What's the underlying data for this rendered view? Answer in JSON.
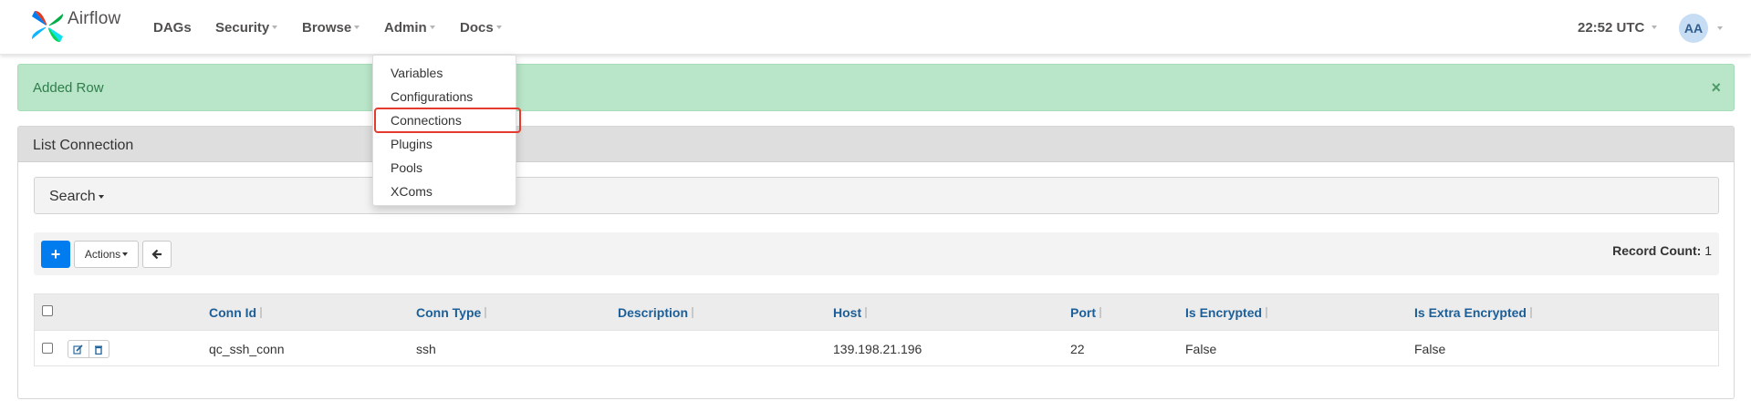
{
  "navbar": {
    "logo_text": "Airflow",
    "items": [
      {
        "label": "DAGs",
        "has_caret": false
      },
      {
        "label": "Security",
        "has_caret": true
      },
      {
        "label": "Browse",
        "has_caret": true
      },
      {
        "label": "Admin",
        "has_caret": true
      },
      {
        "label": "Docs",
        "has_caret": true
      }
    ],
    "time": "22:52 UTC",
    "user_initials": "AA"
  },
  "admin_menu": {
    "items": [
      "Variables",
      "Configurations",
      "Connections",
      "Plugins",
      "Pools",
      "XComs"
    ],
    "highlighted": "Connections"
  },
  "alert": {
    "text": "Added Row",
    "close_icon": "close-icon",
    "color": "#b9e6c9"
  },
  "panel": {
    "title": "List Connection",
    "search_label": "Search",
    "add_icon": "plus-icon",
    "actions_label": "Actions",
    "back_icon": "arrow-left-icon",
    "record_count_label": "Record Count:",
    "record_count": "1"
  },
  "table": {
    "columns": [
      "Conn Id",
      "Conn Type",
      "Description",
      "Host",
      "Port",
      "Is Encrypted",
      "Is Extra Encrypted"
    ],
    "rows": [
      {
        "conn_id": "qc_ssh_conn",
        "conn_type": "ssh",
        "description": "",
        "host": "139.198.21.196",
        "port": "22",
        "is_encrypted": "False",
        "is_extra_encrypted": "False"
      }
    ]
  },
  "colors": {
    "accent": "#017cee",
    "header_link": "#1c5f98",
    "highlight": "#e53b2e"
  }
}
